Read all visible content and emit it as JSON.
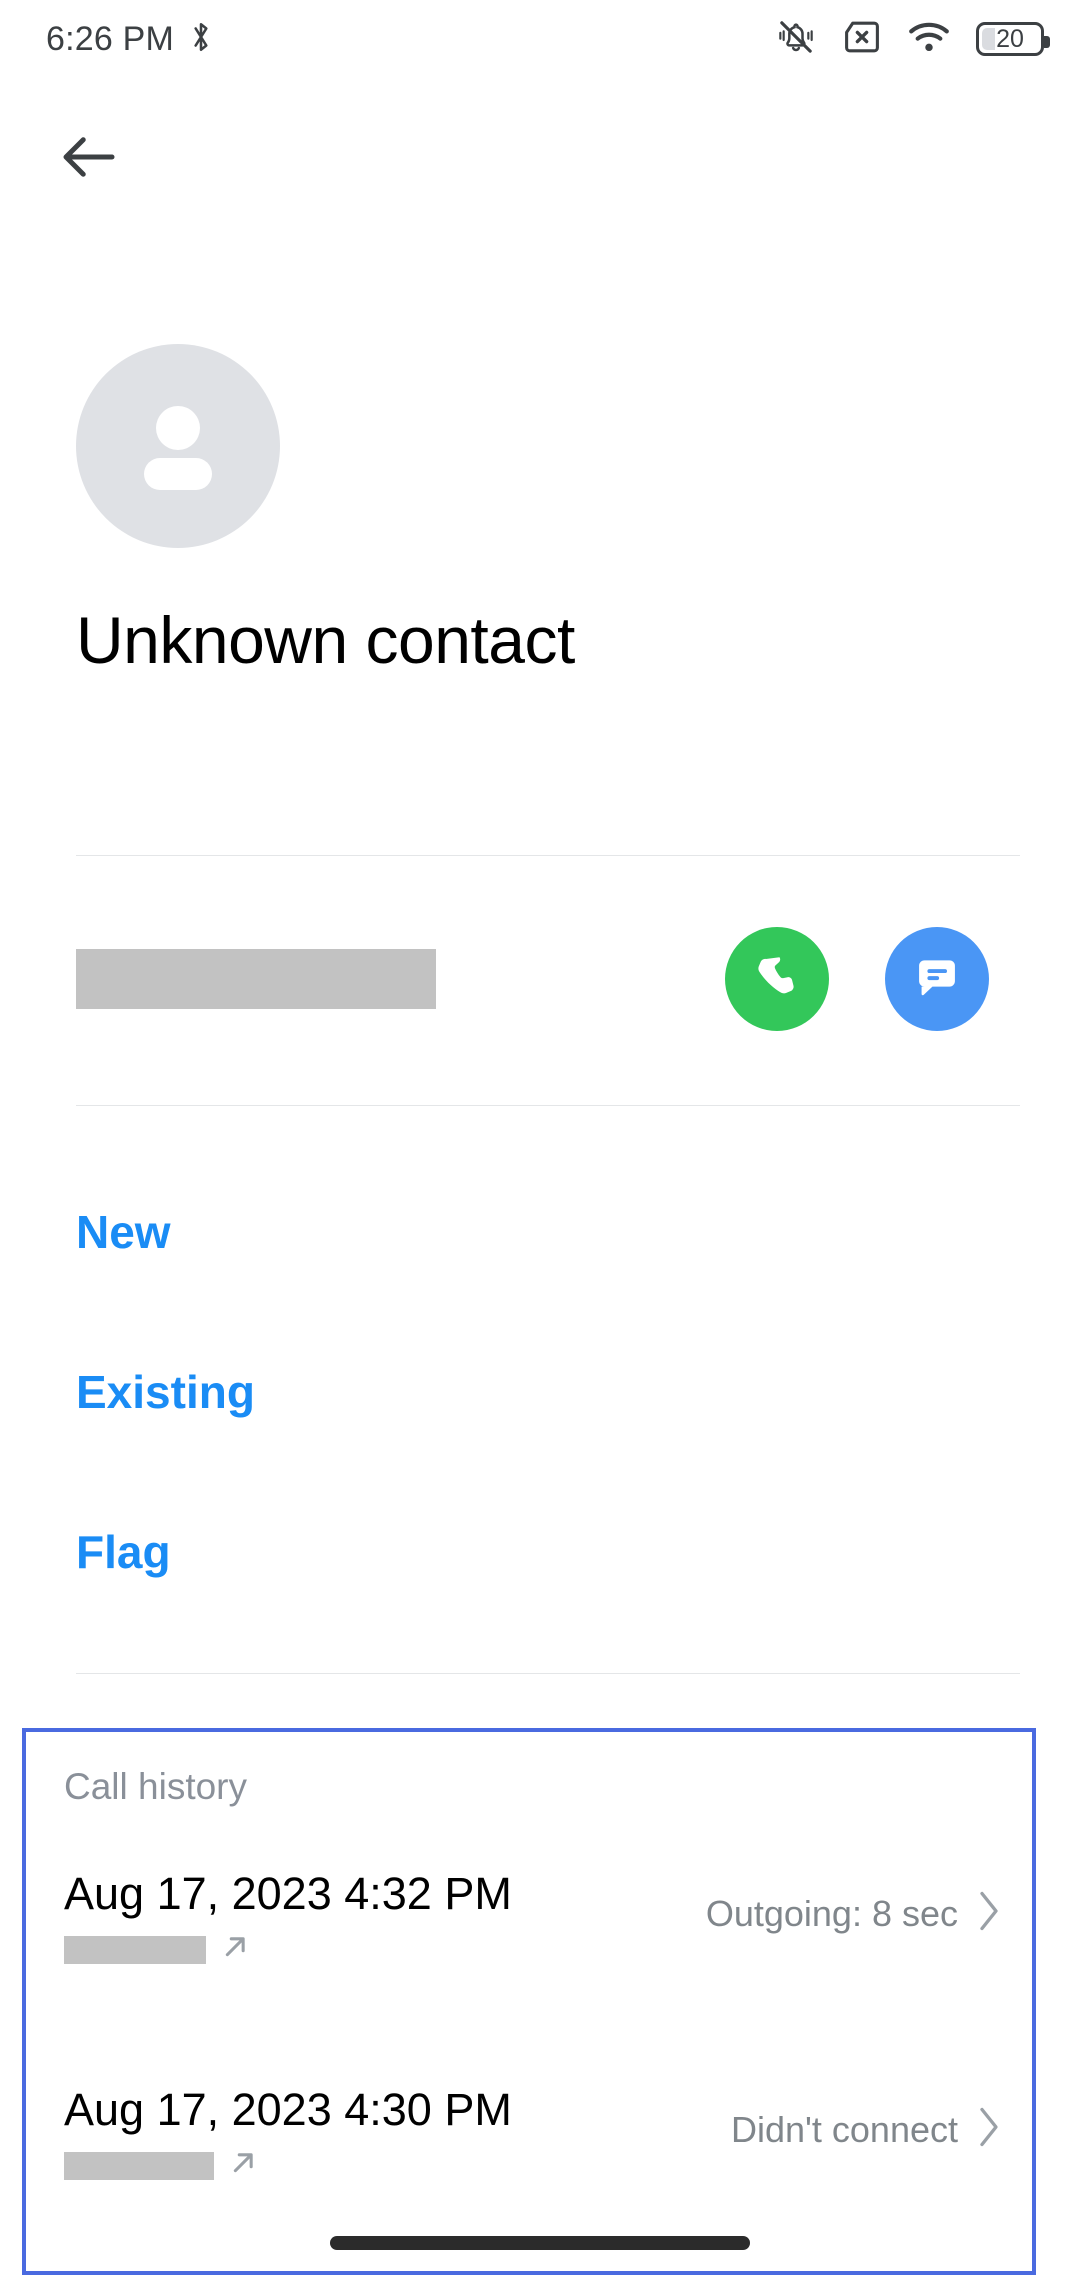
{
  "status_bar": {
    "time": "6:26 PM",
    "bluetooth_icon": "bluetooth-icon",
    "vibrate_off_icon": "notifications-off-icon",
    "no_sim_icon": "sim-card-x-icon",
    "wifi_icon": "wifi-icon",
    "battery_icon": "battery-icon",
    "battery_level": "20"
  },
  "nav": {
    "back_icon": "arrow-back-icon"
  },
  "header": {
    "avatar_icon": "person-avatar-icon",
    "contact_name": "Unknown contact"
  },
  "phone_row": {
    "number_redacted": "",
    "call_icon": "phone-icon",
    "message_icon": "message-bubble-icon"
  },
  "actions": [
    {
      "label": "New"
    },
    {
      "label": "Existing"
    },
    {
      "label": "Flag"
    }
  ],
  "call_history": {
    "title": "Call history",
    "entries": [
      {
        "datetime": "Aug 17, 2023 4:32 PM",
        "number_redacted": "",
        "direction_icon": "outgoing-call-arrow-icon",
        "status": "Outgoing: 8 sec",
        "chevron_icon": "chevron-right-icon"
      },
      {
        "datetime": "Aug 17, 2023 4:30 PM",
        "number_redacted": "",
        "direction_icon": "outgoing-call-arrow-icon",
        "status": "Didn't connect",
        "chevron_icon": "chevron-right-icon"
      }
    ]
  },
  "colors": {
    "link_blue": "#1a8cf5",
    "call_green": "#33c75a",
    "message_blue": "#4a96f5",
    "card_border_blue": "#4a6ae0",
    "status_text": "#3c4043",
    "muted_text": "#80868b"
  },
  "system": {
    "gesture_bar": "home-gesture-bar"
  }
}
